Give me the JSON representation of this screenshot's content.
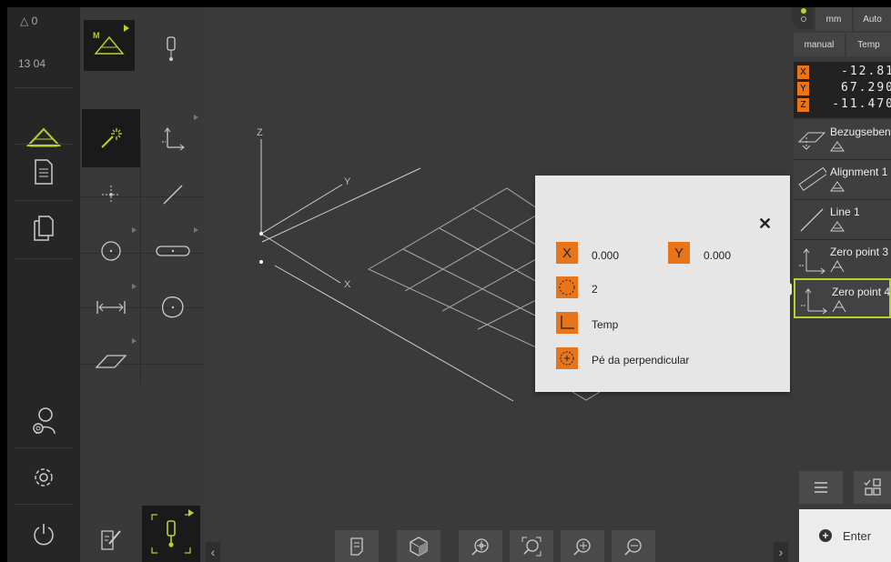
{
  "status": {
    "warnings": "△ 0",
    "time": "13 04"
  },
  "units": {
    "length": "mm",
    "mode": "Auto",
    "method": "manual",
    "system": "Temp"
  },
  "coordinates": [
    {
      "axis": "X",
      "value": "-12.81"
    },
    {
      "axis": "Y",
      "value": "67.290"
    },
    {
      "axis": "Z",
      "value": "-11.470"
    }
  ],
  "features": [
    {
      "name": "Bezugsebene",
      "icon": "plane-icon"
    },
    {
      "name": "Alignment 1",
      "icon": "alignment-icon"
    },
    {
      "name": "Line 1",
      "icon": "line-icon"
    },
    {
      "name": "Zero point 3",
      "icon": "zero-point-icon"
    },
    {
      "name": "Zero point 4",
      "icon": "zero-point-icon",
      "selected": true
    }
  ],
  "canvas": {
    "axis_x": "X",
    "axis_y": "Y",
    "axis_z": "Z"
  },
  "popup": {
    "x_label": "X",
    "x_value": "0.000",
    "y_label": "Y",
    "y_value": "0.000",
    "count": "2",
    "coord_system": "Temp",
    "construction": "Pé da perpendicular"
  },
  "enter_label": "Enter",
  "palette_badge": "M",
  "colors": {
    "accent": "#e8751a",
    "highlight": "#b8d22c",
    "active_tile": "#1a1a1a"
  }
}
